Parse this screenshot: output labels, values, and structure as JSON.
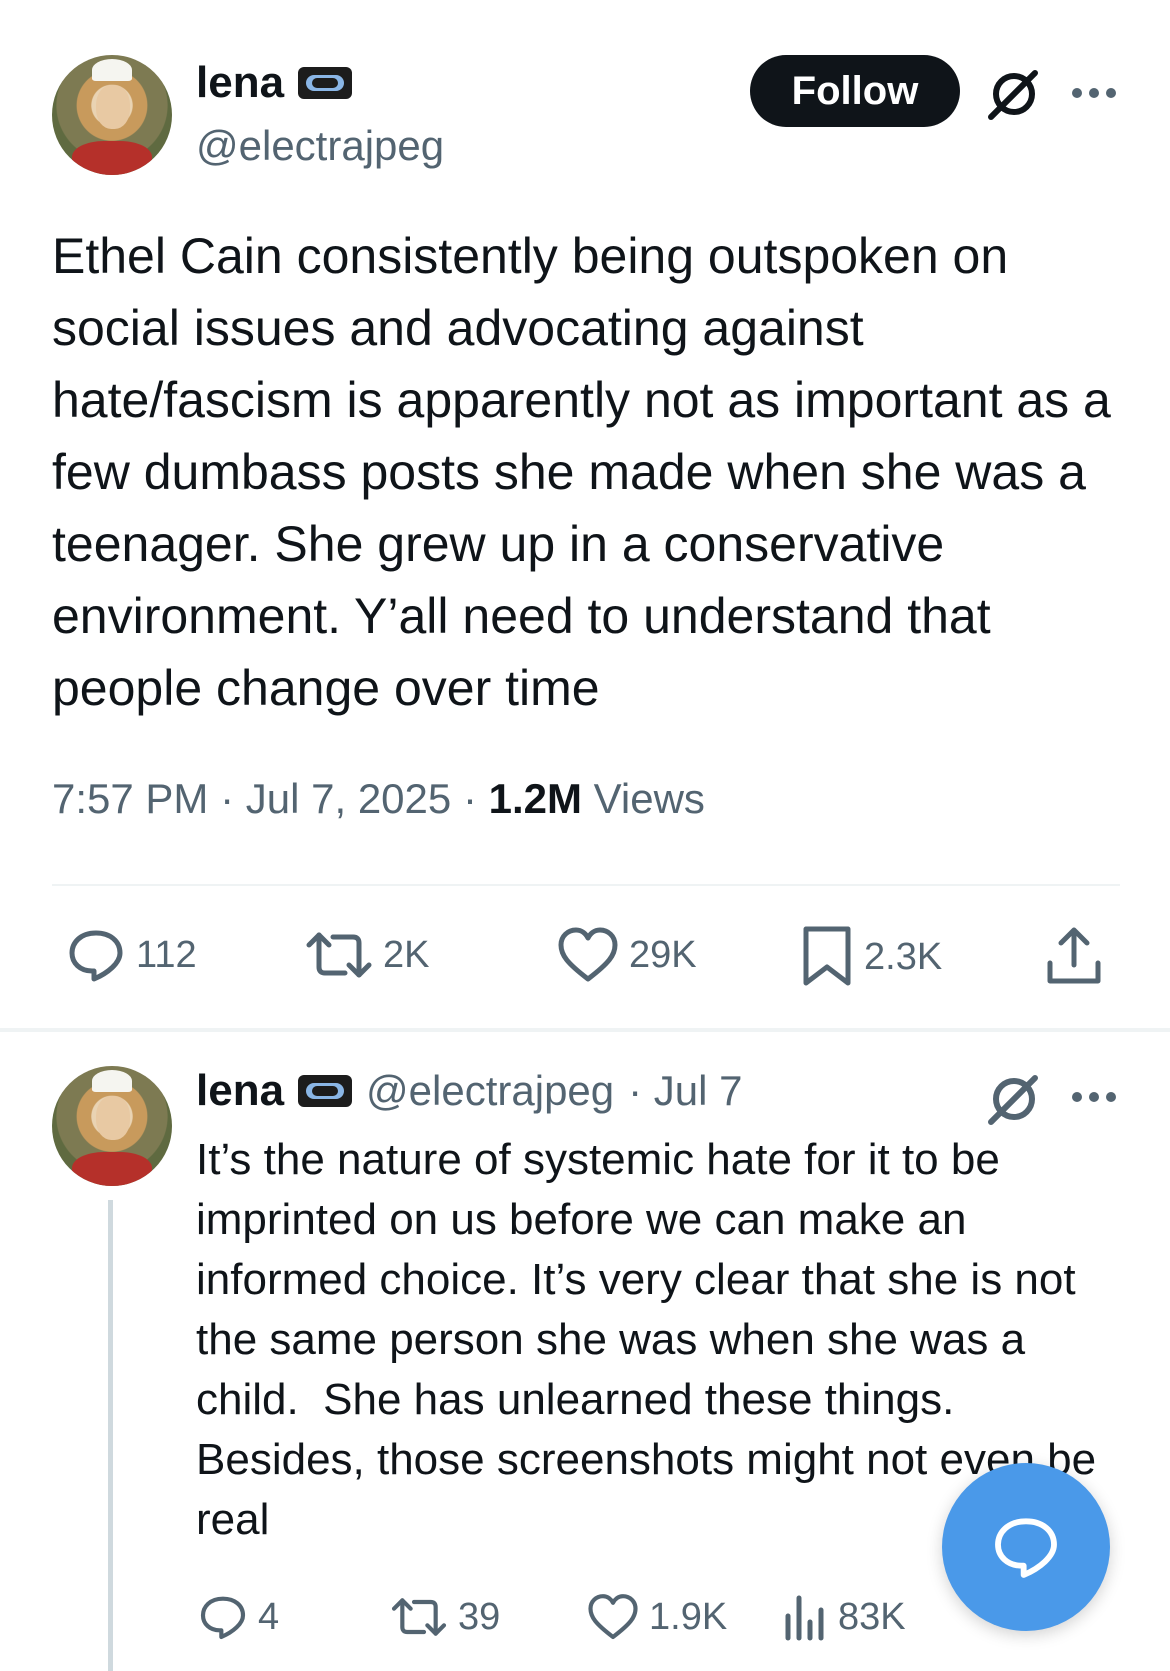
{
  "tweet": {
    "author_name": "lena",
    "author_handle": "@electrajpeg",
    "follow_label": "Follow",
    "text": "Ethel Cain consistently being outspoken on social issues and advocating against hate/fascism is apparently not as important as a few dumbass posts she made when she was a teenager. She grew up in a conservative environment. Y’all need to understand that people change over time",
    "time": "7:57 PM",
    "date": "Jul 7, 2025",
    "separator": "·",
    "views_count": "1.2M",
    "views_label": "Views",
    "replies": "112",
    "reposts": "2K",
    "likes": "29K",
    "bookmarks": "2.3K"
  },
  "reply": {
    "author_name": "lena",
    "author_handle": "@electrajpeg",
    "date": "· Jul 7",
    "text": "It’s the nature of systemic hate for it to be imprinted on us before we can make an informed choice. It’s very clear that she is not the same person she was when she was a child.  She has unlearned these things. Besides, those screenshots might not even be real",
    "replies": "4",
    "reposts": "39",
    "likes": "1.9K",
    "views": "83K"
  },
  "icons": [
    "grok-icon",
    "more-icon",
    "reply-icon",
    "repost-icon",
    "like-icon",
    "bookmark-icon",
    "share-icon",
    "views-icon",
    "compose-reply-icon"
  ],
  "colors": {
    "text": "#0f1419",
    "muted": "#536471",
    "accent": "#4a99e9"
  }
}
